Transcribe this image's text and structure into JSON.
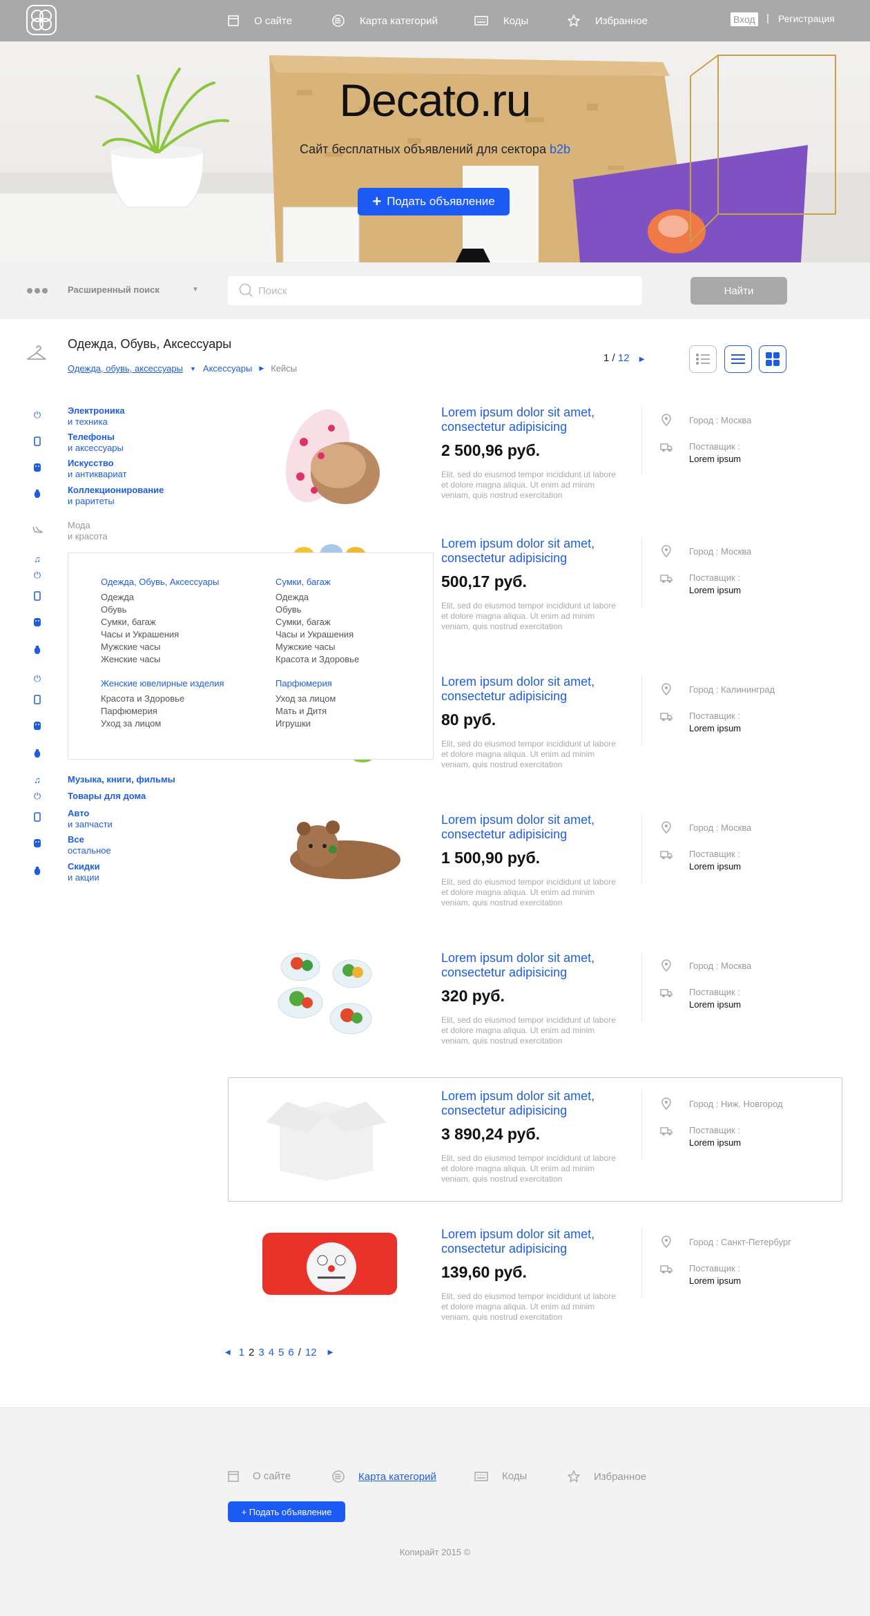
{
  "header": {
    "nav": [
      {
        "label": "О сайте",
        "icon": "document-icon"
      },
      {
        "label": "Карта категорий",
        "icon": "list-circle-icon"
      },
      {
        "label": "Коды",
        "icon": "keyboard-icon"
      },
      {
        "label": "Избранное",
        "icon": "star-icon"
      }
    ],
    "login": "Вход",
    "separator": "|",
    "register": "Регистрация"
  },
  "hero": {
    "title": "Decato.ru",
    "subtitle": "Сайт бесплатных объявлений для сектора",
    "subtitle_highlight": "b2b",
    "post_button": "Подать объявление",
    "post_button_plus": "+"
  },
  "search": {
    "advanced_label": "Расширенный поиск",
    "placeholder": "Поиск",
    "button": "Найти"
  },
  "category": {
    "title": "Одежда, Обувь, Аксессуары",
    "breadcrumbs": [
      "Одежда, обувь, аксессуары",
      "Аксессуары",
      "Кейсы"
    ],
    "page_current": "1",
    "page_sep": "/",
    "page_total": "12"
  },
  "sidebar": [
    {
      "title": "Электроника",
      "sub": "и техника"
    },
    {
      "title": "Телефоны",
      "sub": "и аксессуары"
    },
    {
      "title": "Искусство",
      "sub": "и антиквариат"
    },
    {
      "title": "Коллекционирование",
      "sub": "и раритеты"
    },
    {
      "title": "Мода",
      "sub": "и красота"
    },
    {
      "title": "Музыка, книги, фильмы",
      "sub": ""
    },
    {
      "title": "Товары для дома",
      "sub": ""
    },
    {
      "title": "Авто",
      "sub": "и запчасти"
    },
    {
      "title": "Все",
      "sub": "остальное"
    },
    {
      "title": "Скидки",
      "sub": "и акции"
    }
  ],
  "dropdown": {
    "columns": [
      {
        "groups": [
          {
            "heading": "Одежда, Обувь, Аксессуары",
            "items": [
              "Одежда",
              "Обувь",
              "Сумки, багаж",
              "Часы и Украшения",
              "Мужские часы",
              "Женские часы"
            ]
          },
          {
            "heading": "Женские ювелирные изделия",
            "items": [
              "Красота и Здоровье",
              "Парфюмерия",
              "Уход за лицом"
            ]
          }
        ]
      },
      {
        "groups": [
          {
            "heading": "Сумки, багаж",
            "items": [
              "Одежда",
              "Обувь",
              "Сумки, багаж",
              "Часы и Украшения",
              "Мужские часы",
              "Красота и Здоровье"
            ]
          },
          {
            "heading": "Парфюмерия",
            "items": [
              "Уход за лицом",
              "Мать и Дитя",
              "Игрушки"
            ]
          }
        ]
      }
    ]
  },
  "products": [
    {
      "title": "Lorem ipsum dolor sit amet, consectetur adipisicing",
      "price": "2 500,96 руб.",
      "desc": "Elit, sed do eiusmod tempor incididunt ut labore et dolore magna aliqua. Ut enim ad minim veniam, quis nostrud exercitation",
      "city": "Город : Москва",
      "supplier_label": "Поставщик :",
      "supplier": "Lorem ipsum",
      "image": "slippers"
    },
    {
      "title": "Lorem ipsum dolor sit amet, consectetur adipisicing",
      "price": "500,17 руб.",
      "desc": "Elit, sed do eiusmod tempor incididunt ut labore et dolore magna aliqua. Ut enim ad minim veniam, quis nostrud exercitation",
      "city": "Город : Москва",
      "supplier_label": "Поставщик :",
      "supplier": "Lorem ipsum",
      "image": "toy"
    },
    {
      "title": "Lorem ipsum dolor sit amet, consectetur adipisicing",
      "price": "80 руб.",
      "desc": "Elit, sed do eiusmod tempor incididunt ut labore et dolore magna aliqua. Ut enim ad minim veniam, quis nostrud exercitation",
      "city": "Город : Калининград",
      "supplier_label": "Поставщик :",
      "supplier": "Lorem ipsum",
      "image": "green"
    },
    {
      "title": "Lorem ipsum dolor sit amet, consectetur adipisicing",
      "price": "1 500,90 руб.",
      "desc": "Elit, sed do eiusmod tempor incididunt ut labore et dolore magna aliqua. Ut enim ad minim veniam, quis nostrud exercitation",
      "city": "Город : Москва",
      "supplier_label": "Поставщик :",
      "supplier": "Lorem ipsum",
      "image": "bear"
    },
    {
      "title": "Lorem ipsum dolor sit amet, consectetur adipisicing",
      "price": "320 руб.",
      "desc": "Elit, sed do eiusmod tempor incididunt ut labore et dolore magna aliqua. Ut enim ad minim veniam, quis nostrud exercitation",
      "city": "Город : Москва",
      "supplier_label": "Поставщик :",
      "supplier": "Lorem ipsum",
      "image": "salad"
    },
    {
      "title": "Lorem ipsum dolor sit amet, consectetur adipisicing",
      "price": "3 890,24 руб.",
      "desc": "Elit, sed do eiusmod tempor incididunt ut labore et dolore magna aliqua. Ut enim ad minim veniam, quis nostrud exercitation",
      "city": "Город : Ниж. Новгород",
      "supplier_label": "Поставщик :",
      "supplier": "Lorem ipsum",
      "image": "box-placeholder"
    },
    {
      "title": "Lorem ipsum dolor sit amet, consectetur adipisicing",
      "price": "139,60 руб.",
      "desc": "Elit, sed do eiusmod tempor incididunt ut labore et dolore magna aliqua. Ut enim ad minim veniam, quis nostrud exercitation",
      "city": "Город : Санкт-Петербург",
      "supplier_label": "Поставщик :",
      "supplier": "Lorem ipsum",
      "image": "pillow"
    }
  ],
  "pagination": {
    "pages": [
      "1",
      "2",
      "3",
      "4",
      "5",
      "6"
    ],
    "current": "2",
    "sep": "/",
    "total": "12"
  },
  "footer": {
    "nav": [
      {
        "label": "О сайте"
      },
      {
        "label": "Карта категорий"
      },
      {
        "label": "Коды"
      },
      {
        "label": "Избранное"
      }
    ],
    "post_button": "+ Подать объявление",
    "copyright": "Копирайт 2015 ©"
  },
  "colors": {
    "accent": "#1f5de0",
    "button": "#1b5bf4",
    "topbar": "#a9a9a9"
  }
}
